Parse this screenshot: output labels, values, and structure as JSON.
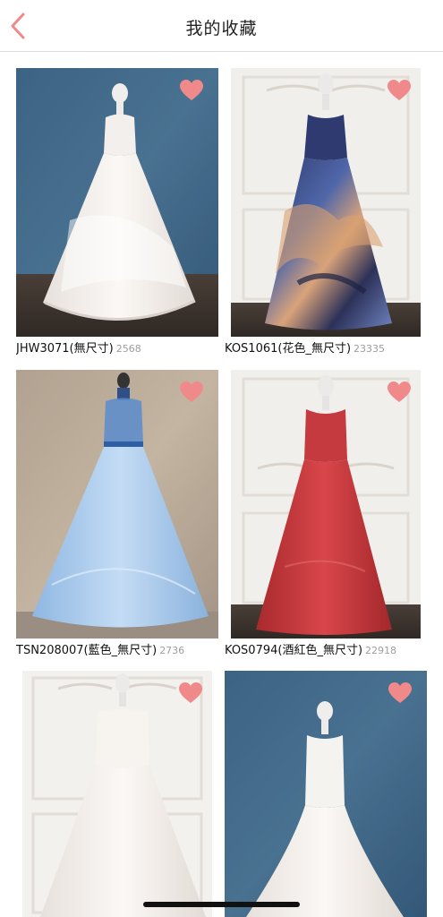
{
  "header": {
    "title": "我的收藏",
    "back_icon": "chevron-left-icon",
    "accent_color": "#F08A8A"
  },
  "favorites": [
    {
      "name": "JHW3071(無尺寸)",
      "count": "2568",
      "heart_icon": "heart-icon",
      "dress_color": "#F3EEEA",
      "backdrop": "blue-textured"
    },
    {
      "name": "KOS1061(花色_無尺寸)",
      "count": "23335",
      "heart_icon": "heart-icon",
      "dress_color": "#3C4C8C",
      "backdrop": "white-panel"
    },
    {
      "name": "TSN208007(藍色_無尺寸)",
      "count": "2736",
      "heart_icon": "heart-icon",
      "dress_color": "#A9CBEE",
      "backdrop": "tan-mottled"
    },
    {
      "name": "KOS0794(酒紅色_無尺寸)",
      "count": "22918",
      "heart_icon": "heart-icon",
      "dress_color": "#C3393C",
      "backdrop": "white-panel"
    },
    {
      "name": "",
      "count": "",
      "heart_icon": "heart-icon",
      "dress_color": "#F7F4EF",
      "backdrop": "white-panel"
    },
    {
      "name": "",
      "count": "",
      "heart_icon": "heart-icon",
      "dress_color": "#F5F3F0",
      "backdrop": "blue-textured"
    }
  ]
}
